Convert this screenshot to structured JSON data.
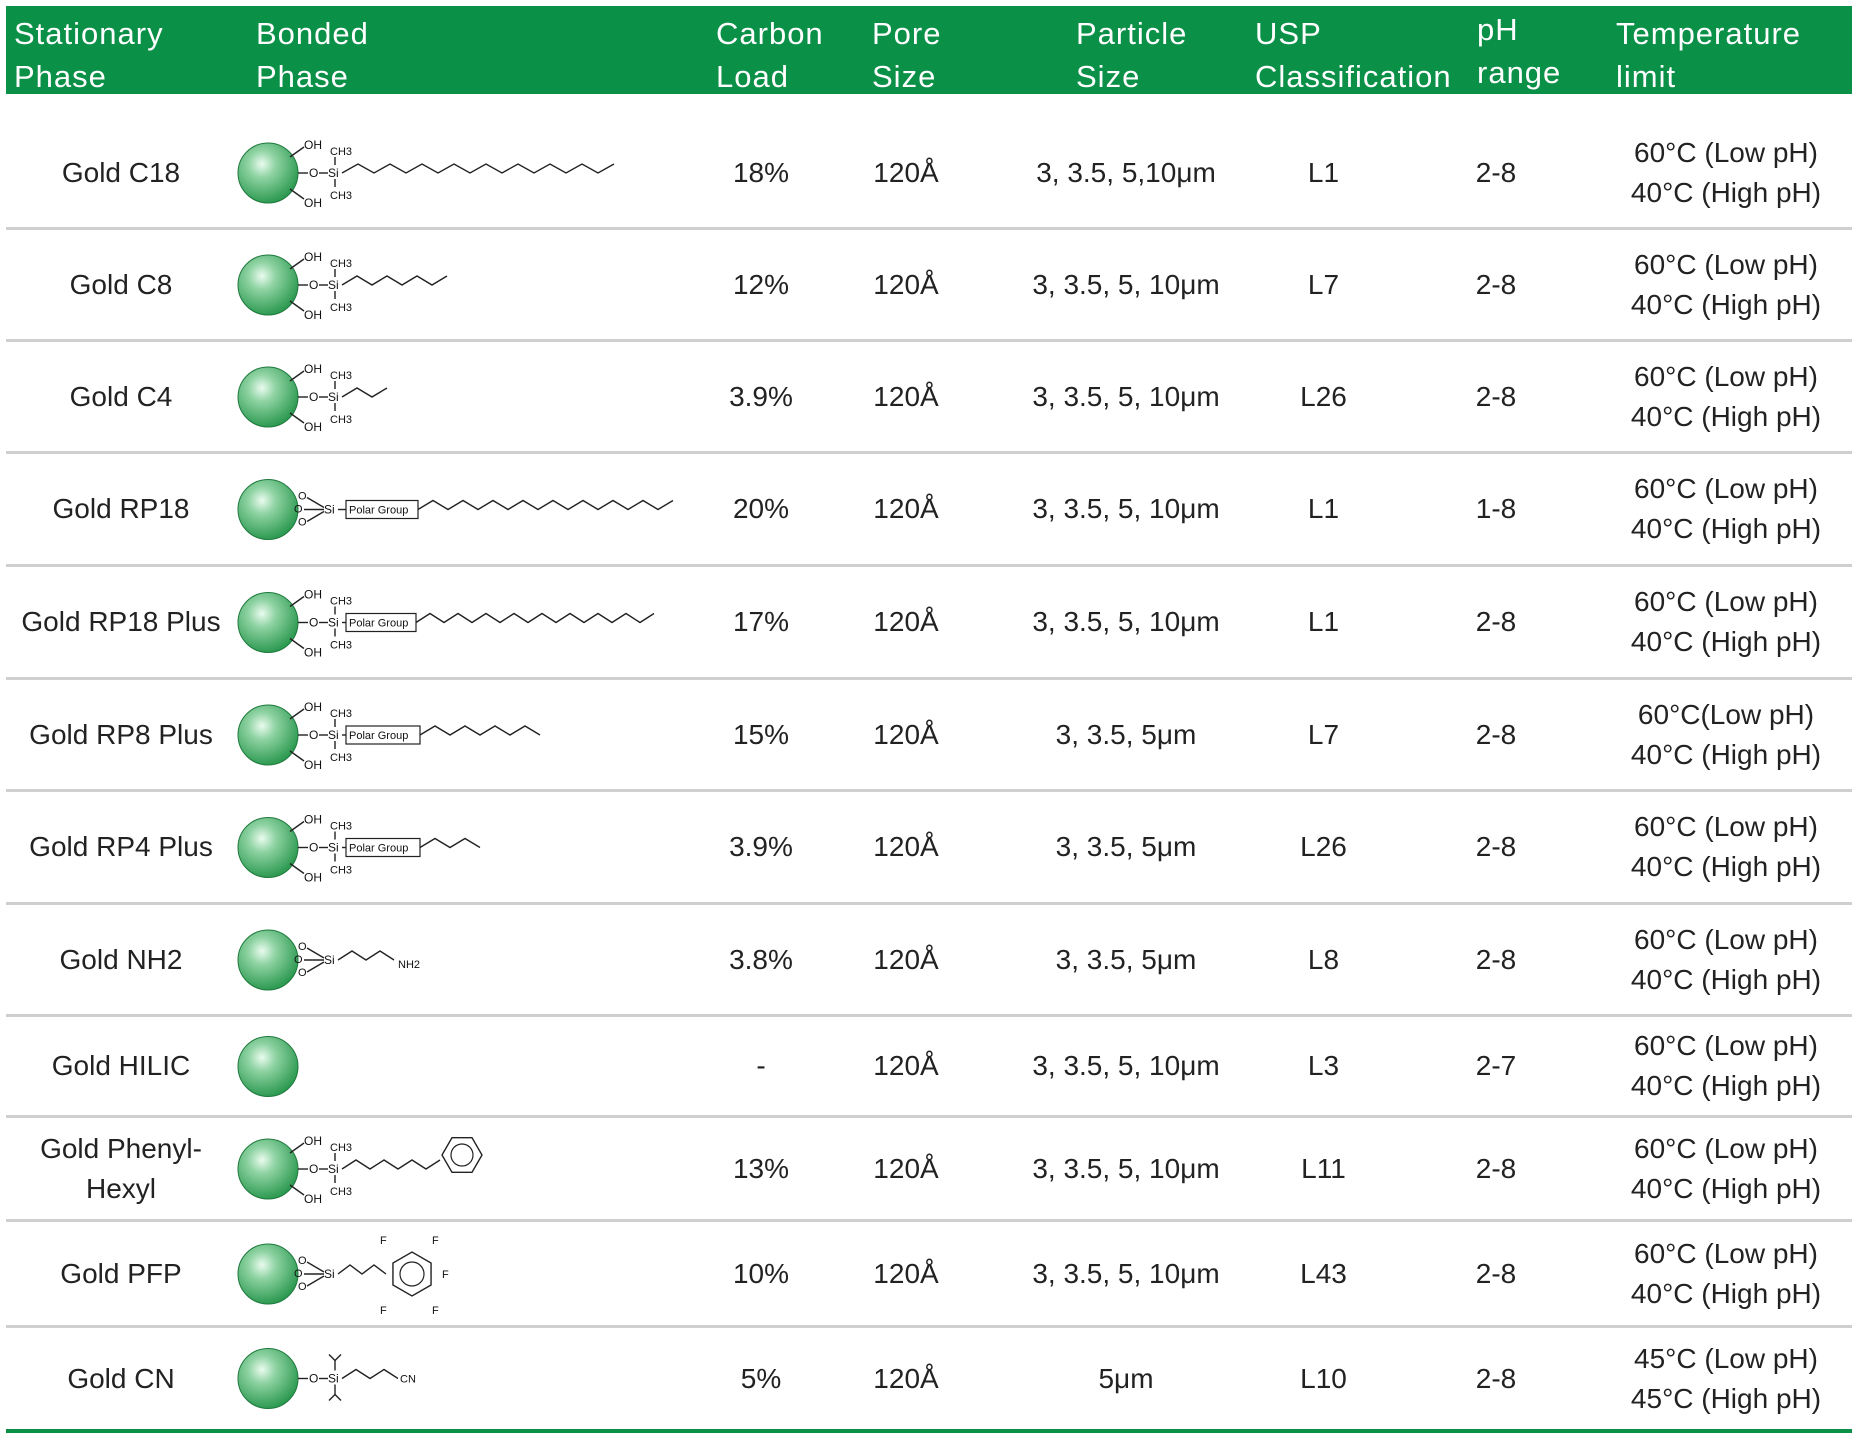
{
  "headers": {
    "stationary_phase": [
      "Stationary",
      "Phase"
    ],
    "bonded_phase": [
      "Bonded",
      "Phase"
    ],
    "carbon_load": [
      "Carbon",
      "Load"
    ],
    "pore_size": [
      "Pore",
      "Size"
    ],
    "particle_size": [
      "Particle",
      "Size"
    ],
    "usp_classification": [
      "USP",
      "Classification"
    ],
    "ph_range": [
      "pH",
      "range"
    ],
    "temperature_limit": [
      "Temperature",
      "limit"
    ]
  },
  "colors": {
    "header_bg": "#0b9048",
    "bead": "#2e9a52",
    "row_divider": "#cfcfcf"
  },
  "structure_labels": {
    "oh": "OH",
    "o": "O",
    "si": "Si",
    "ch3": "CH3",
    "polar_group": "Polar Group",
    "nh2": "NH2",
    "cn": "CN",
    "f": "F"
  },
  "rows": [
    {
      "name": [
        "Gold C18"
      ],
      "structure": "c18-chain",
      "carbon_load": "18%",
      "pore_size": "120Å",
      "particle_size": "3, 3.5, 5,10μm",
      "usp": "L1",
      "ph_range": "2-8",
      "temp_low": "60°C (Low pH)",
      "temp_high": "40°C (High pH)"
    },
    {
      "name": [
        "Gold C8"
      ],
      "structure": "c8-chain",
      "carbon_load": "12%",
      "pore_size": "120Å",
      "particle_size": "3, 3.5, 5, 10μm",
      "usp": "L7",
      "ph_range": "2-8",
      "temp_low": "60°C (Low pH)",
      "temp_high": "40°C (High pH)"
    },
    {
      "name": [
        "Gold C4"
      ],
      "structure": "c4-chain",
      "carbon_load": "3.9%",
      "pore_size": "120Å",
      "particle_size": "3, 3.5, 5, 10μm",
      "usp": "L26",
      "ph_range": "2-8",
      "temp_low": "60°C (Low pH)",
      "temp_high": "40°C (High pH)"
    },
    {
      "name": [
        "Gold RP18"
      ],
      "structure": "rp18-trifunctional",
      "carbon_load": "20%",
      "pore_size": "120Å",
      "particle_size": "3, 3.5, 5, 10μm",
      "usp": "L1",
      "ph_range": "1-8",
      "temp_low": "60°C (Low pH)",
      "temp_high": "40°C (High pH)"
    },
    {
      "name": [
        "Gold RP18 Plus"
      ],
      "structure": "rp18-plus",
      "carbon_load": "17%",
      "pore_size": "120Å",
      "particle_size": "3, 3.5, 5, 10μm",
      "usp": "L1",
      "ph_range": "2-8",
      "temp_low": "60°C (Low pH)",
      "temp_high": "40°C (High pH)"
    },
    {
      "name": [
        "Gold RP8 Plus"
      ],
      "structure": "rp8-plus",
      "carbon_load": "15%",
      "pore_size": "120Å",
      "particle_size": "3, 3.5, 5μm",
      "usp": "L7",
      "ph_range": "2-8",
      "temp_low": "60°C(Low pH)",
      "temp_high": "40°C (High pH)"
    },
    {
      "name": [
        "Gold RP4 Plus"
      ],
      "structure": "rp4-plus",
      "carbon_load": "3.9%",
      "pore_size": "120Å",
      "particle_size": "3, 3.5, 5μm",
      "usp": "L26",
      "ph_range": "2-8",
      "temp_low": "60°C (Low pH)",
      "temp_high": "40°C (High pH)"
    },
    {
      "name": [
        "Gold NH2"
      ],
      "structure": "nh2",
      "carbon_load": "3.8%",
      "pore_size": "120Å",
      "particle_size": "3, 3.5, 5μm",
      "usp": "L8",
      "ph_range": "2-8",
      "temp_low": "60°C (Low pH)",
      "temp_high": "40°C (High pH)"
    },
    {
      "name": [
        "Gold HILIC"
      ],
      "structure": "hilic-bare",
      "carbon_load": "-",
      "pore_size": "120Å",
      "particle_size": "3, 3.5, 5, 10μm",
      "usp": "L3",
      "ph_range": "2-7",
      "temp_low": "60°C (Low pH)",
      "temp_high": "40°C (High pH)"
    },
    {
      "name": [
        "Gold Phenyl-",
        "Hexyl"
      ],
      "structure": "phenyl-hexyl",
      "carbon_load": "13%",
      "pore_size": "120Å",
      "particle_size": "3, 3.5, 5, 10μm",
      "usp": "L11",
      "ph_range": "2-8",
      "temp_low": "60°C (Low pH)",
      "temp_high": "40°C (High pH)"
    },
    {
      "name": [
        "Gold PFP"
      ],
      "structure": "pfp",
      "carbon_load": "10%",
      "pore_size": "120Å",
      "particle_size": "3, 3.5, 5, 10μm",
      "usp": "L43",
      "ph_range": "2-8",
      "temp_low": "60°C (Low pH)",
      "temp_high": "40°C (High pH)"
    },
    {
      "name": [
        "Gold CN"
      ],
      "structure": "cn",
      "carbon_load": "5%",
      "pore_size": "120Å",
      "particle_size": "5μm",
      "usp": "L10",
      "ph_range": "2-8",
      "temp_low": "45°C (Low pH)",
      "temp_high": "45°C (High pH)"
    }
  ]
}
